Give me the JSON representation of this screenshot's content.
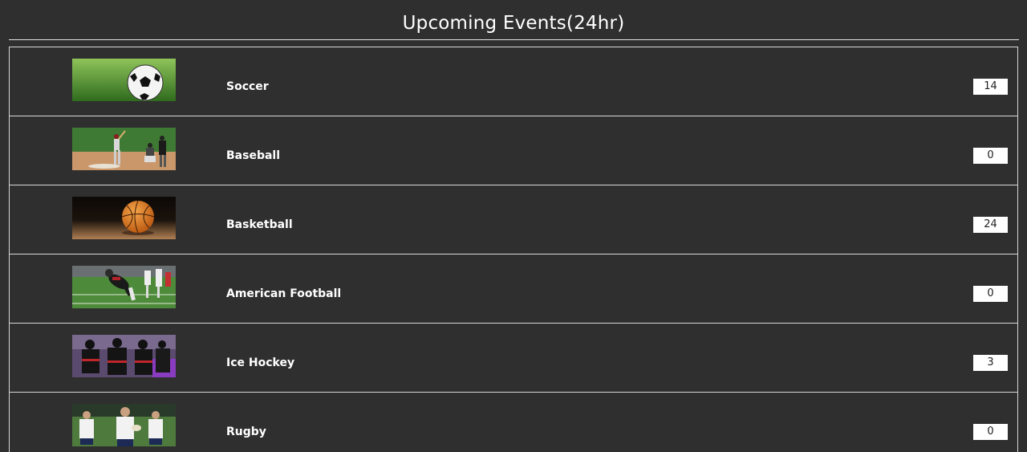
{
  "header": {
    "title": "Upcoming Events(24hr)"
  },
  "events": [
    {
      "name": "Soccer",
      "count": "14",
      "icon": "soccer-ball-image"
    },
    {
      "name": "Baseball",
      "count": "0",
      "icon": "baseball-players-image"
    },
    {
      "name": "Basketball",
      "count": "24",
      "icon": "basketball-image"
    },
    {
      "name": "American Football",
      "count": "0",
      "icon": "football-player-image"
    },
    {
      "name": "Ice Hockey",
      "count": "3",
      "icon": "hockey-players-image"
    },
    {
      "name": "Rugby",
      "count": "0",
      "icon": "rugby-players-image"
    }
  ],
  "colors": {
    "background": "#2f2f2f",
    "text": "#ffffff",
    "border": "#d8d8d8",
    "count_box": "#ffffff"
  }
}
